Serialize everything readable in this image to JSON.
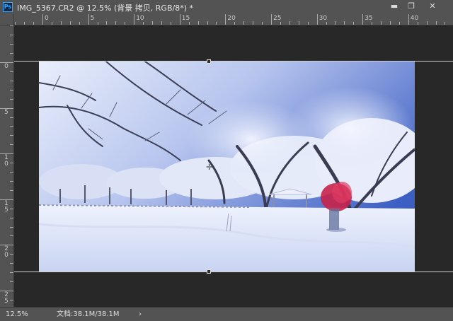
{
  "window": {
    "app_icon": "Ps",
    "title": "IMG_5367.CR2 @ 12.5% (背景 拷贝, RGB/8*) *",
    "minimize": "▬",
    "maximize": "❐",
    "close": "✕"
  },
  "ruler": {
    "horizontal_labels": [
      "0",
      "5",
      "10",
      "15",
      "20",
      "25",
      "30",
      "35",
      "40"
    ],
    "vertical_labels": [
      "0",
      "5",
      "10",
      "15",
      "20",
      "25"
    ]
  },
  "status": {
    "zoom": "12.5%",
    "doc_info": "文档:38.1M/38.1M",
    "arrow": "›"
  },
  "colors": {
    "chrome": "#535353",
    "pasteboard": "#282828",
    "subject_jacket": "#c8234a"
  },
  "icons": {
    "app": "photoshop-icon",
    "crosshair": "crosshair-cursor-icon"
  }
}
